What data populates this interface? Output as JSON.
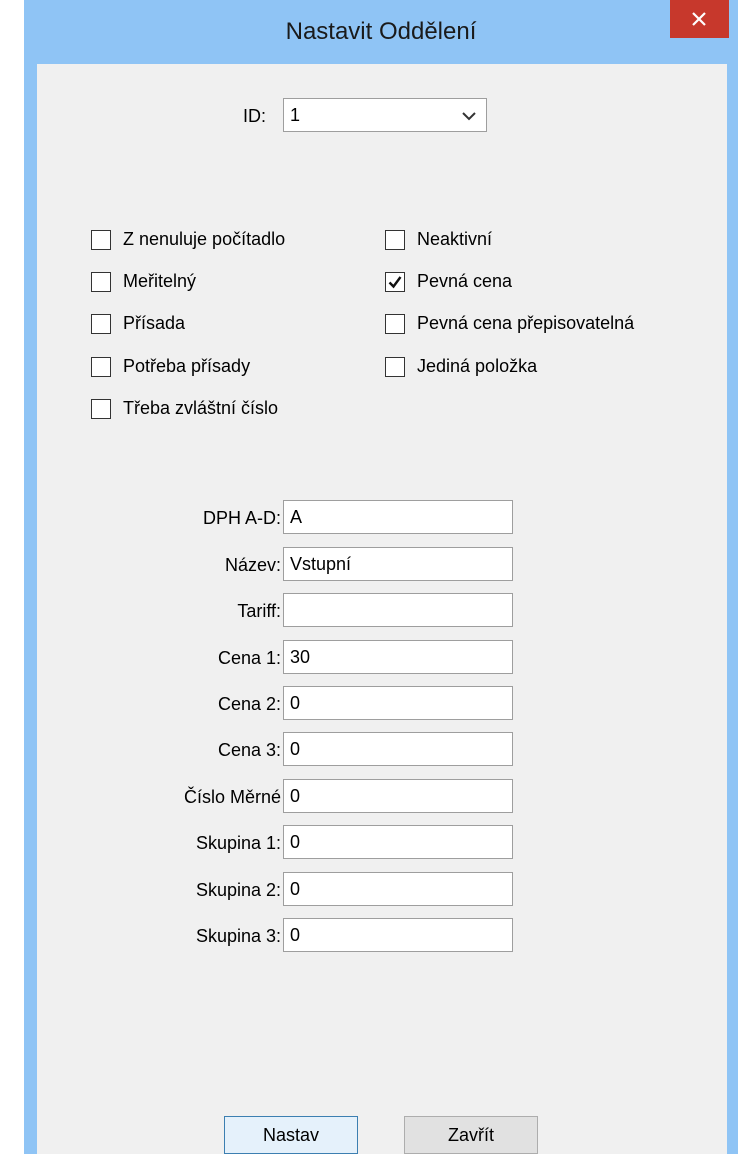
{
  "window": {
    "title": "Nastavit Oddělení",
    "close_glyph": "✕"
  },
  "id_field": {
    "label": "ID:",
    "value": "1"
  },
  "checkboxes": [
    {
      "label": "Z nenuluje počítadlo",
      "checked": false
    },
    {
      "label": "Meřitelný",
      "checked": false
    },
    {
      "label": "Přísada",
      "checked": false
    },
    {
      "label": "Potřeba přísady",
      "checked": false
    },
    {
      "label": "Třeba zvláštní číslo",
      "checked": false
    },
    {
      "label": "Neaktivní",
      "checked": false
    },
    {
      "label": "Pevná cena",
      "checked": true
    },
    {
      "label": "Pevná cena přepisovatelná",
      "checked": false
    },
    {
      "label": "Jediná položka",
      "checked": false
    }
  ],
  "fields": [
    {
      "label": "DPH A-D:",
      "value": "A"
    },
    {
      "label": "Název:",
      "value": "Vstupní"
    },
    {
      "label": "Tariff:",
      "value": ""
    },
    {
      "label": "Cena 1:",
      "value": "30"
    },
    {
      "label": "Cena 2:",
      "value": "0"
    },
    {
      "label": "Cena 3:",
      "value": "0"
    },
    {
      "label": "Číslo Měrné",
      "value": "0"
    },
    {
      "label": "Skupina 1:",
      "value": "0"
    },
    {
      "label": "Skupina 2:",
      "value": "0"
    },
    {
      "label": "Skupina 3:",
      "value": "0"
    }
  ],
  "buttons": {
    "set": "Nastav",
    "close": "Zavřít"
  },
  "colors": {
    "frame": "#8fc4f5",
    "close": "#c7382c",
    "client": "#f0f0f0"
  }
}
